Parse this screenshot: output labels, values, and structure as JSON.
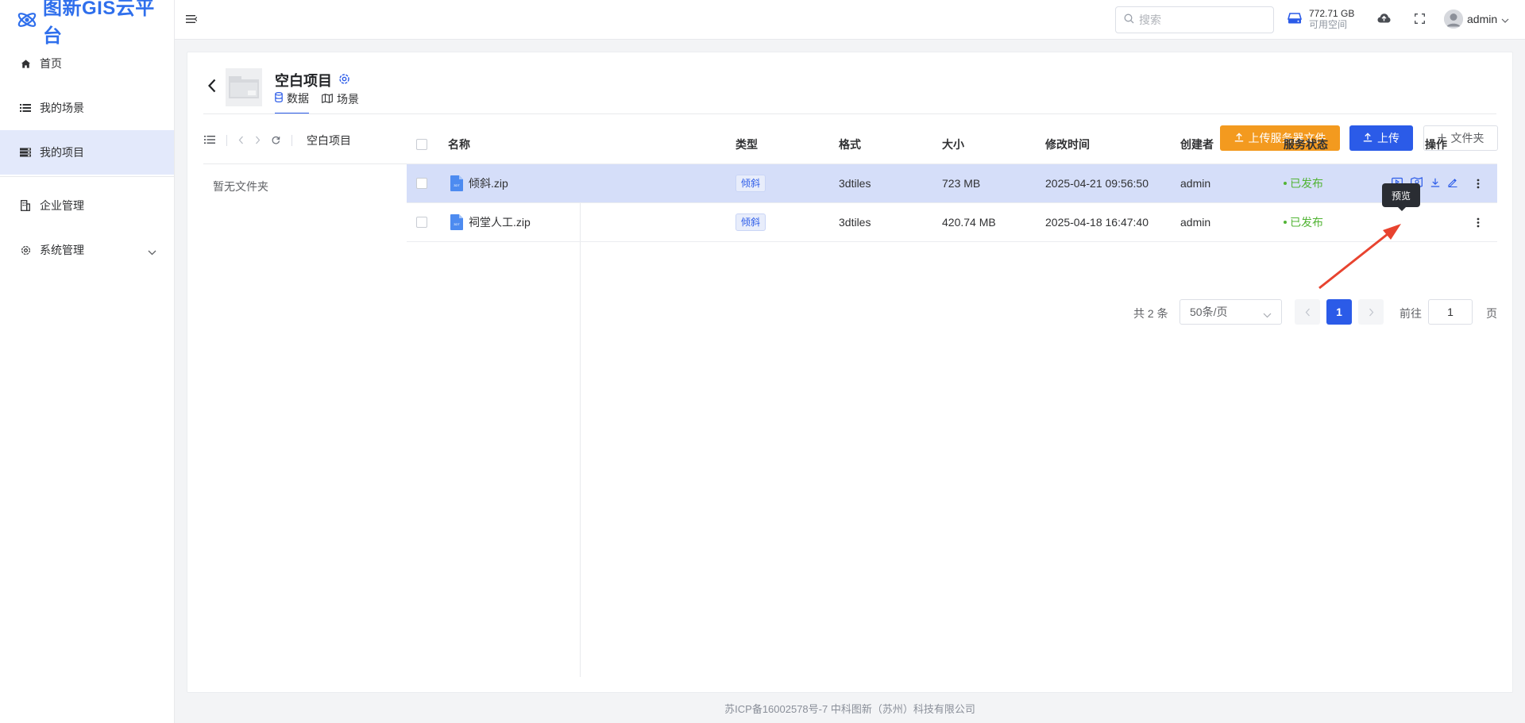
{
  "app": {
    "logo_text": "图新GIS云平台",
    "accent": "#2b5be8",
    "orange": "#f39a1f",
    "success": "#52b435"
  },
  "sidebar": {
    "items": [
      {
        "label": "首页",
        "icon": "home-icon"
      },
      {
        "label": "我的场景",
        "icon": "list-icon"
      },
      {
        "label": "我的项目",
        "icon": "project-icon",
        "active": true
      },
      {
        "label": "企业管理",
        "icon": "building-icon"
      },
      {
        "label": "系统管理",
        "icon": "settings-icon",
        "expandable": true
      }
    ]
  },
  "topbar": {
    "search_placeholder": "搜索",
    "storage_value": "772.71 GB",
    "storage_label": "可用空间",
    "username": "admin"
  },
  "project": {
    "title": "空白项目",
    "tabs": [
      {
        "label": "数据",
        "active": true
      },
      {
        "label": "场景",
        "active": false
      }
    ],
    "breadcrumb": "空白项目",
    "buttons": {
      "upload_server": "上传服务器文件",
      "upload": "上传",
      "folder": "文件夹"
    },
    "folder_empty": "暂无文件夹"
  },
  "table": {
    "headers": {
      "name": "名称",
      "type": "类型",
      "format": "格式",
      "size": "大小",
      "modified": "修改时间",
      "creator": "创建者",
      "status": "服务状态",
      "ops": "操作"
    },
    "rows": [
      {
        "name": "倾斜.zip",
        "type": "倾斜",
        "format": "3dtiles",
        "size": "723 MB",
        "modified": "2025-04-21 09:56:50",
        "creator": "admin",
        "status": "已发布"
      },
      {
        "name": "祠堂人工.zip",
        "type": "倾斜",
        "format": "3dtiles",
        "size": "420.74 MB",
        "modified": "2025-04-18 16:47:40",
        "creator": "admin",
        "status": "已发布"
      }
    ],
    "tooltip": "预览"
  },
  "pagination": {
    "total": "共 2 条",
    "page_size": "50条/页",
    "current_page": "1",
    "goto_label": "前往",
    "goto_value": "1",
    "page_suffix": "页"
  },
  "footer": "苏ICP备16002578号-7 中科图新（苏州）科技有限公司"
}
